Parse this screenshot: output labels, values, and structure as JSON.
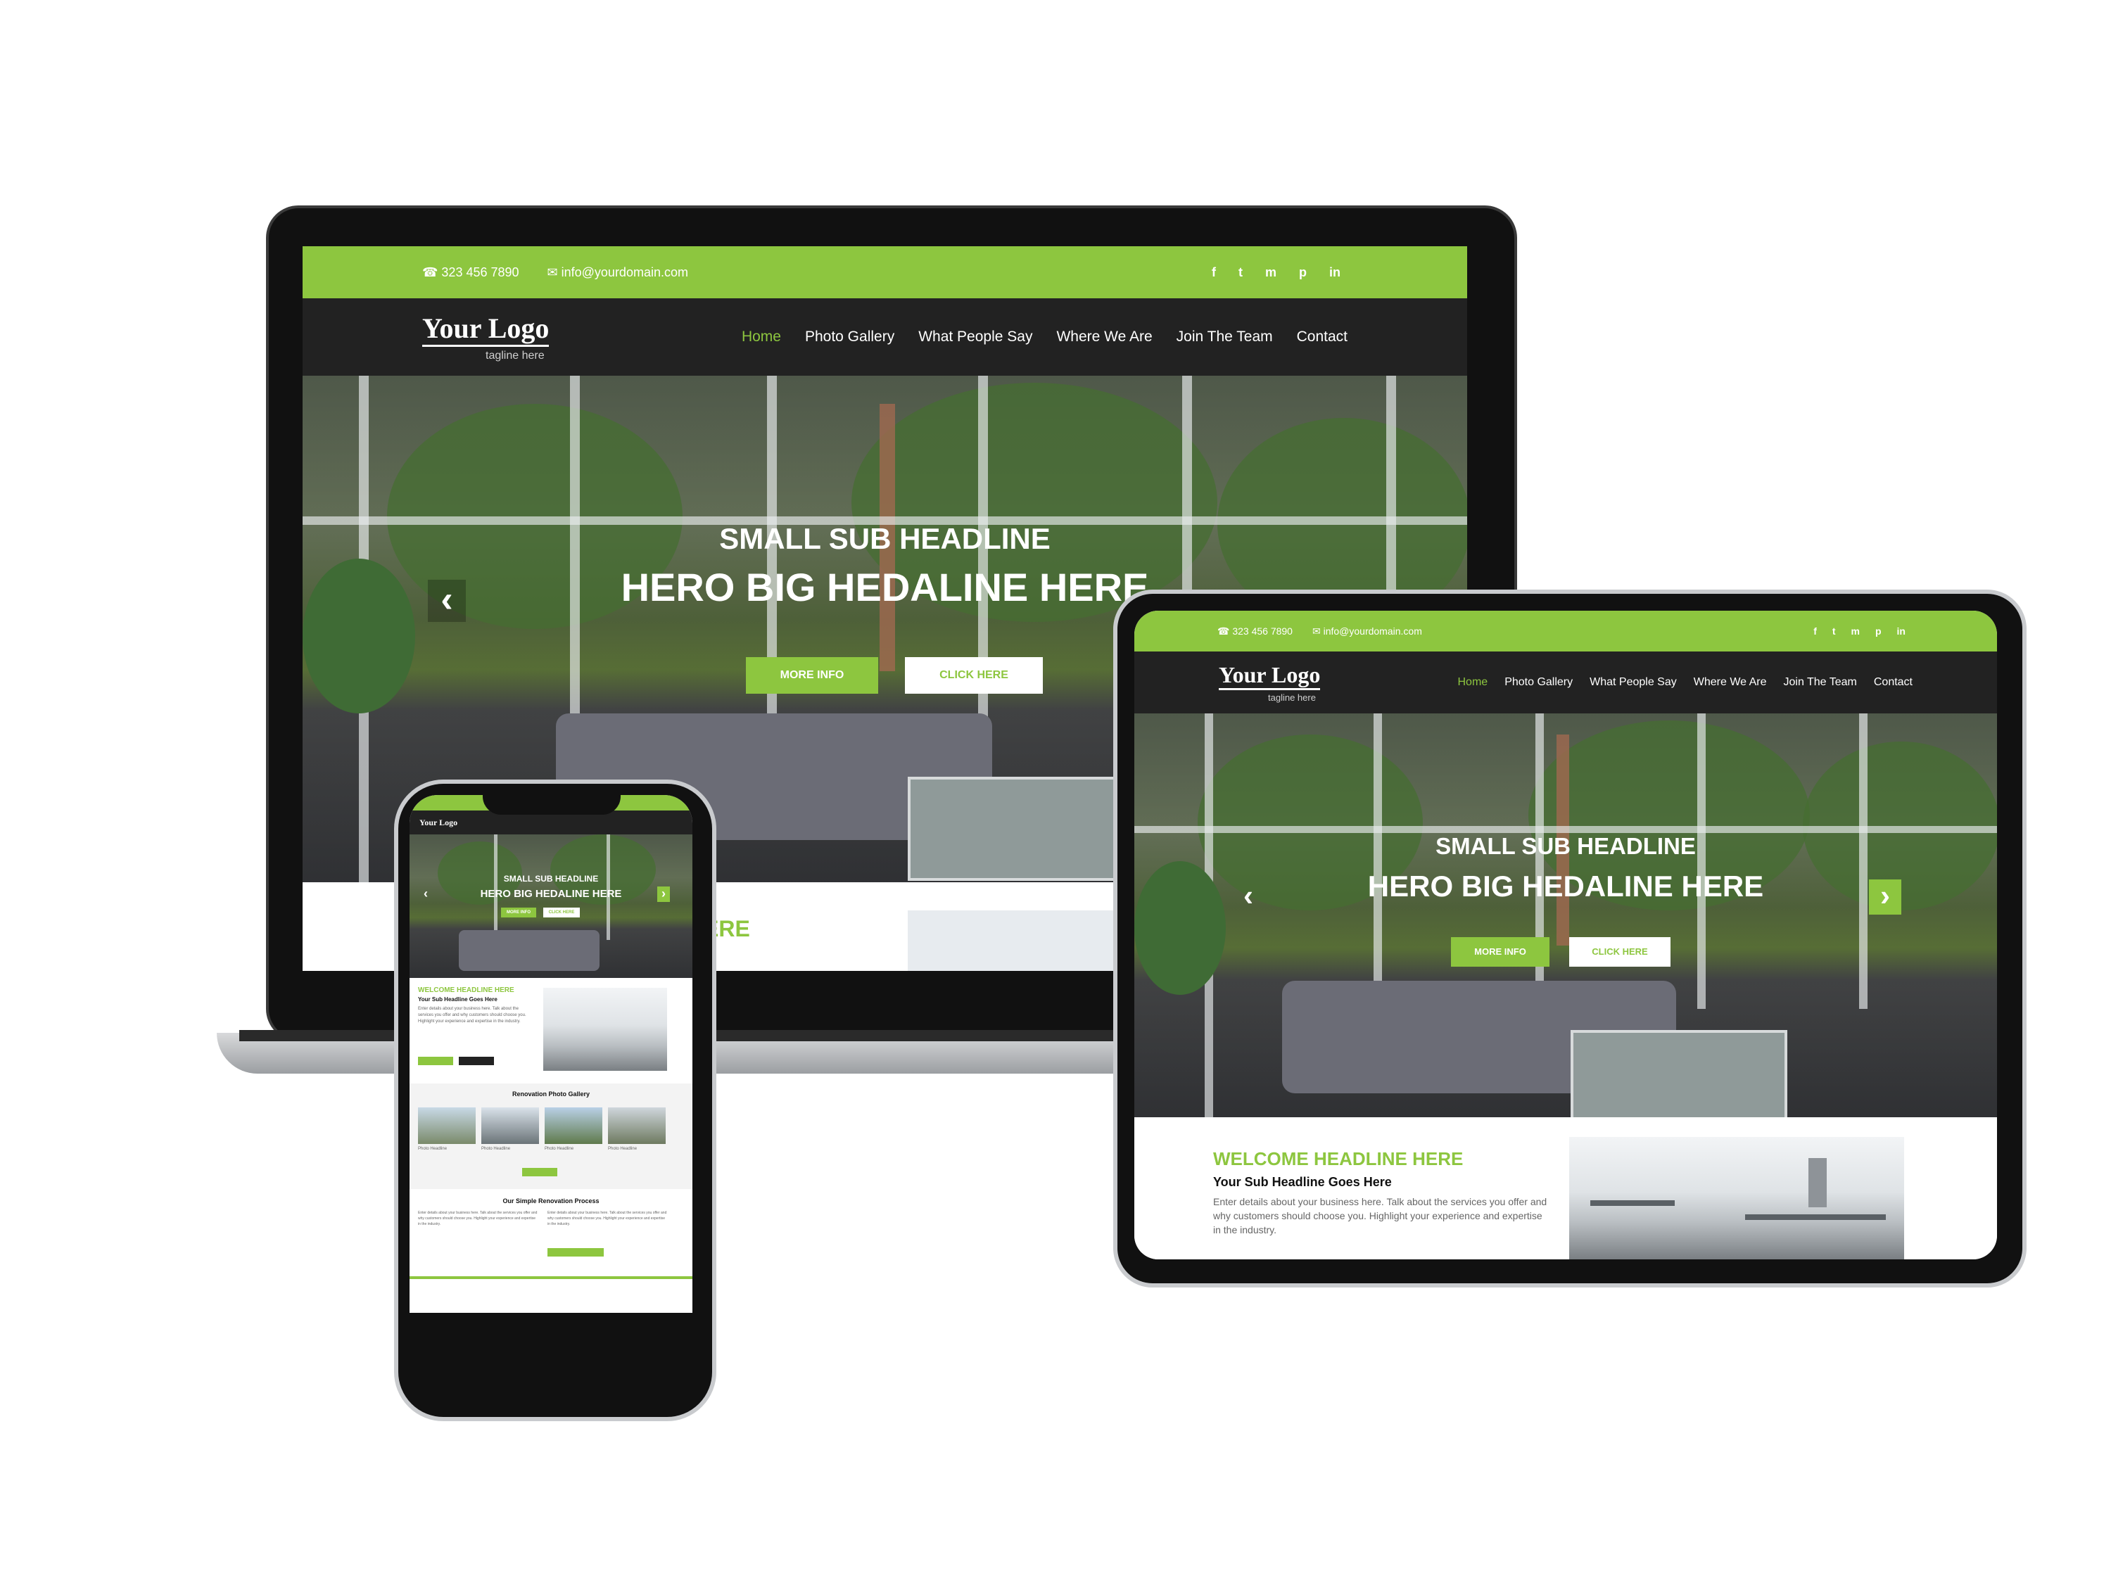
{
  "site": {
    "phone": "323 456 7890",
    "email": "info@yourdomain.com",
    "logo_title": "Your Logo",
    "logo_tagline": "tagline here",
    "social_icons": [
      "facebook-icon",
      "twitter-icon",
      "email-icon",
      "pinterest-icon",
      "linkedin-icon"
    ],
    "social_glyphs": [
      "f",
      "t",
      "m",
      "p",
      "in"
    ],
    "nav": [
      "Home",
      "Photo Gallery",
      "What People Say",
      "Where We Are",
      "Join The Team",
      "Contact"
    ],
    "hero_sub": "SMALL SUB HEADLINE",
    "hero_big": "HERO BIG HEDALINE HERE",
    "btn_primary": "MORE INFO",
    "btn_secondary": "CLICK HERE",
    "arrow_prev": "‹",
    "arrow_next": "›",
    "welcome_headline": "WELCOME HEADLINE HERE",
    "welcome_sub": "Your Sub Headline Goes Here",
    "welcome_para": "Enter details about your business here. Talk about the services you offer and why customers should choose you. Highlight your experience and expertise in the industry.",
    "laptop_peek_text": "ERE",
    "phone_gallery_title": "Renovation Photo Gallery",
    "phone_gallery_captions": [
      "Photo Headline",
      "Photo Headline",
      "Photo Headline",
      "Photo Headline"
    ],
    "phone_process_title": "Our Simple Renovation Process"
  },
  "colors": {
    "accent": "#8dc63f",
    "nav_bg": "#222222",
    "device_frame": "#111111"
  }
}
